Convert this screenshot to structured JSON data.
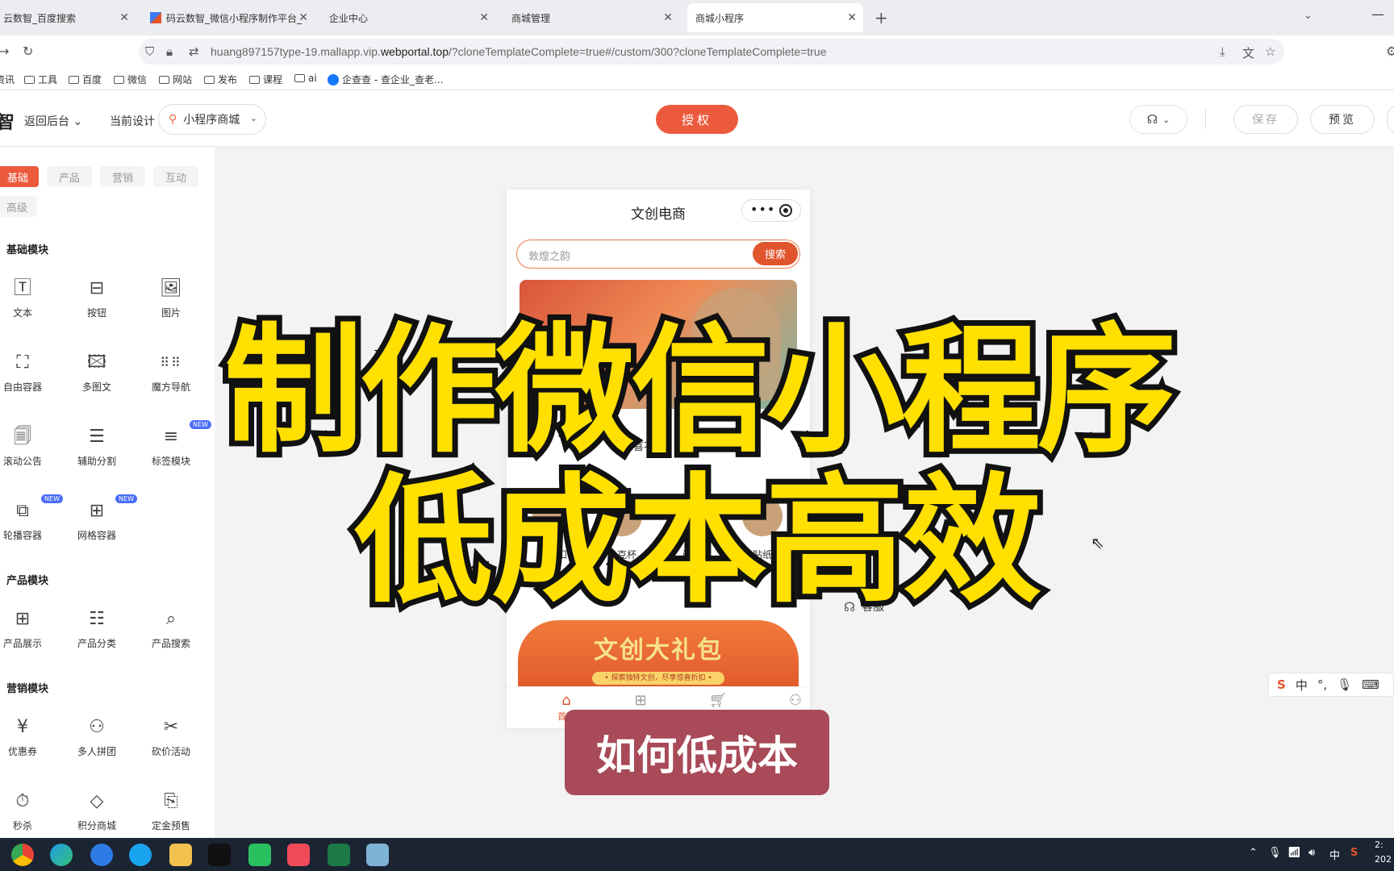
{
  "browser": {
    "tabs": [
      {
        "title": "云数智_百度搜索",
        "active": false
      },
      {
        "title": "码云数智_微信小程序制作平台_",
        "active": false
      },
      {
        "title": "企业中心",
        "active": false
      },
      {
        "title": "商城管理",
        "active": false
      },
      {
        "title": "商城小程序",
        "active": true
      }
    ],
    "url_prefix": "huang897157type-19.mallapp.vip.",
    "url_domain": "webportal.top",
    "url_suffix": "/?cloneTemplateComplete=true#/custom/300?cloneTemplateComplete=true",
    "bookmarks": [
      "资讯",
      "工具",
      "百度",
      "微信",
      "网站",
      "发布",
      "课程",
      "ai",
      "企查查 - 查企业_查老..."
    ]
  },
  "header": {
    "logo_fragment": "智",
    "back_label": "返回后台",
    "current_design_label": "当前设计",
    "design_select_value": "小程序商城",
    "authorize_label": "授权",
    "save_label": "保存",
    "preview_label": "预览"
  },
  "left_panel": {
    "categories": [
      "基础",
      "产品",
      "营销",
      "互动",
      "高级"
    ],
    "basic_title": "基础模块",
    "basic_items": [
      {
        "label": "文本",
        "icon": "text-icon",
        "new": false
      },
      {
        "label": "按钮",
        "icon": "button-icon",
        "new": false
      },
      {
        "label": "图片",
        "icon": "image-icon",
        "new": false
      },
      {
        "label": "自由容器",
        "icon": "free-container-icon",
        "new": false
      },
      {
        "label": "多图文",
        "icon": "multi-image-icon",
        "new": false
      },
      {
        "label": "魔方导航",
        "icon": "grid-dots-icon",
        "new": false
      },
      {
        "label": "滚动公告",
        "icon": "notice-icon",
        "new": false
      },
      {
        "label": "辅助分割",
        "icon": "divider-icon",
        "new": false
      },
      {
        "label": "标签模块",
        "icon": "tag-list-icon",
        "new": true
      },
      {
        "label": "轮播容器",
        "icon": "carousel-icon",
        "new": true
      },
      {
        "label": "网格容器",
        "icon": "grid-icon",
        "new": true
      }
    ],
    "product_title": "产品模块",
    "product_items": [
      {
        "label": "产品展示",
        "icon": "product-grid-icon"
      },
      {
        "label": "产品分类",
        "icon": "category-icon"
      },
      {
        "label": "产品搜索",
        "icon": "product-search-icon"
      }
    ],
    "marketing_title": "营销模块",
    "marketing_items": [
      {
        "label": "优惠券",
        "icon": "coupon-icon"
      },
      {
        "label": "多人拼团",
        "icon": "group-buy-icon"
      },
      {
        "label": "砍价活动",
        "icon": "bargain-icon"
      },
      {
        "label": "秒杀",
        "icon": "flash-sale-icon"
      },
      {
        "label": "积分商城",
        "icon": "points-icon"
      },
      {
        "label": "定金预售",
        "icon": "presale-icon"
      }
    ],
    "new_badge": "NEW"
  },
  "phone": {
    "title": "文创电商",
    "search_placeholder": "敦煌之韵",
    "search_button": "搜索",
    "notice_tag": "公告",
    "notice_text": "惊喜不断，      降50%!",
    "products": [
      "钥匙扣",
      "马克杯",
      "画册",
      "贴纸"
    ],
    "gift_title": "文创大礼包",
    "gift_sub": "• 探索独特文创，尽享惊喜折扣 •",
    "tabs": [
      {
        "label": "首页",
        "icon": "home-icon",
        "active": true
      },
      {
        "label": "",
        "icon": "category-icon",
        "active": false
      },
      {
        "label": "",
        "icon": "cart-icon",
        "active": false
      },
      {
        "label": "",
        "icon": "user-icon",
        "active": false
      }
    ]
  },
  "side": {
    "customer_service": "客服"
  },
  "overlay": {
    "line1": "制作微信小程序",
    "line2": "低成本高效",
    "caption": "如何低成本"
  },
  "ime": {
    "mode": "中"
  },
  "tray": {
    "lang": "中",
    "time_fragment": "2:",
    "date_fragment": "202"
  }
}
